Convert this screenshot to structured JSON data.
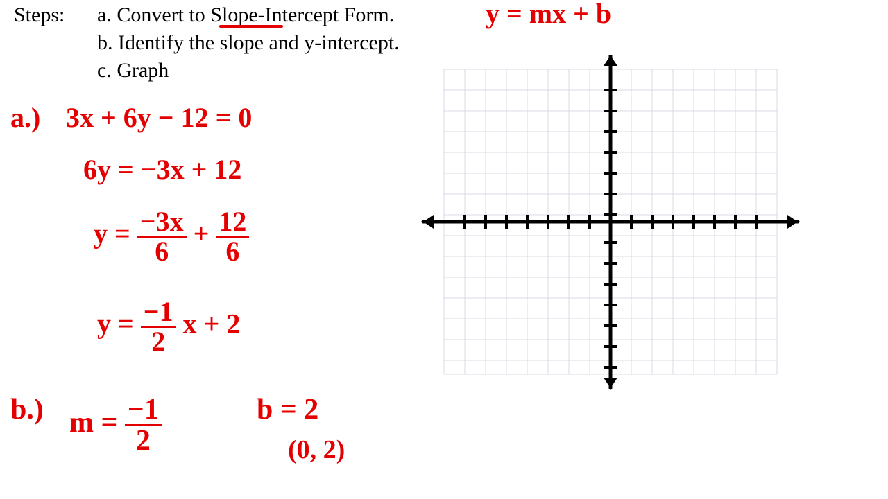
{
  "steps_label": "Steps:",
  "step_a": "a. Convert to Slope-Intercept Form.",
  "step_b": "b. Identify the slope and y-intercept.",
  "step_c": "c. Graph",
  "formula": "y = mx + b",
  "work": {
    "a_label": "a.)",
    "a_line1": "3x + 6y − 12 = 0",
    "a_line2": "6y = −3x + 12",
    "a_line3_pre": "y = ",
    "a_line3_num1": "−3x",
    "a_line3_den1": "6",
    "a_line3_mid": " + ",
    "a_line3_num2": "12",
    "a_line3_den2": "6",
    "a_line4_pre": "y = ",
    "a_line4_num": "−1",
    "a_line4_den": "2",
    "a_line4_post": " x + 2",
    "b_label": "b.)",
    "b_m_pre": "m = ",
    "b_m_num": "−1",
    "b_m_den": "2",
    "b_b": "b =  2",
    "b_point": "(0, 2)"
  },
  "chart_data": {
    "type": "line",
    "title": "",
    "xlabel": "",
    "ylabel": "",
    "xlim": [
      -8,
      8
    ],
    "ylim": [
      -8,
      8
    ],
    "grid": true,
    "series": []
  }
}
